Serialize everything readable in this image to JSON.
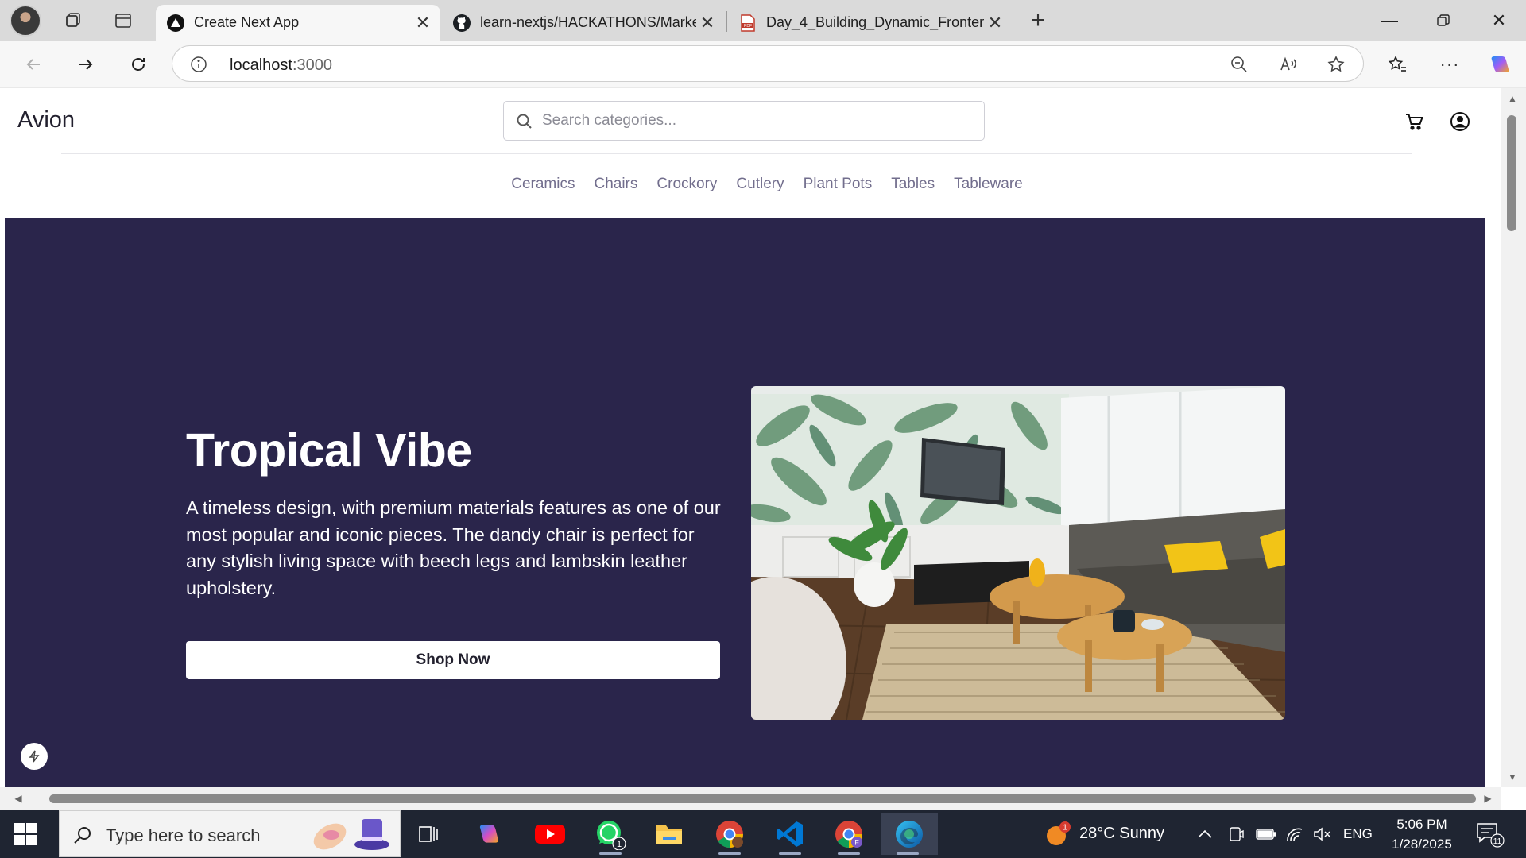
{
  "browser": {
    "tabs": [
      {
        "title": "Create Next App",
        "active": true
      },
      {
        "title": "learn-nextjs/HACKATHONS/Marke",
        "active": false
      },
      {
        "title": "Day_4_Building_Dynamic_Fronten",
        "active": false
      }
    ],
    "address": {
      "host": "localhost",
      "port": ":3000"
    }
  },
  "site": {
    "logo": "Avion",
    "search_placeholder": "Search categories...",
    "categories": [
      "Ceramics",
      "Chairs",
      "Crockory",
      "Cutlery",
      "Plant Pots",
      "Tables",
      "Tableware"
    ],
    "hero": {
      "title": "Tropical Vibe",
      "description": "A timeless design, with premium materials features as one of our most popular and iconic pieces. The dandy chair is perfect for any stylish living space with beech legs and lambskin leather upholstery.",
      "button_label": "Shop Now"
    }
  },
  "taskbar": {
    "search_text": "Type here to search",
    "whatsapp_badge": "1",
    "weather": {
      "badge": "1",
      "text": "28°C  Sunny"
    },
    "language": "ENG",
    "time": "5:06 PM",
    "date": "1/28/2025",
    "notifications": "11"
  },
  "colors": {
    "hero_bg": "#2a254b",
    "nav_text": "#726e8d",
    "logo_text": "#22202e"
  }
}
